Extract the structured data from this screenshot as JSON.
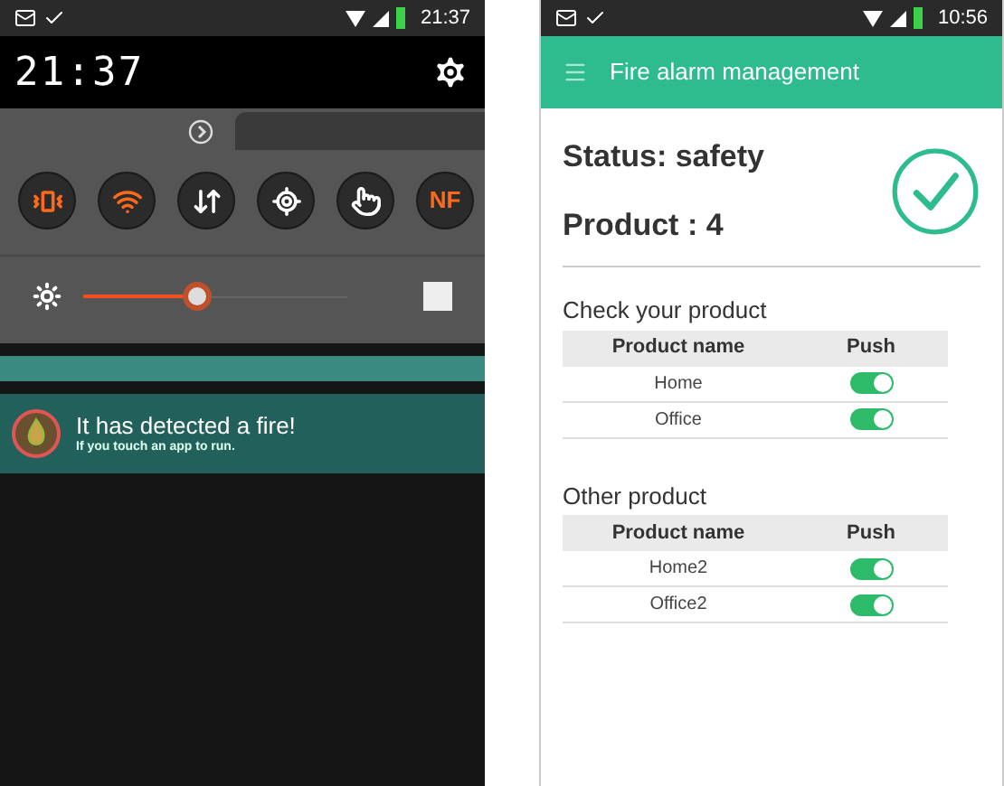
{
  "notification_shade": {
    "status_bar": {
      "time": "21:37"
    },
    "clock": "21:37",
    "toggles": [
      {
        "kind": "vibrate",
        "on": true
      },
      {
        "kind": "wifi",
        "on": true
      },
      {
        "kind": "data",
        "on": false
      },
      {
        "kind": "location",
        "on": false
      },
      {
        "kind": "touch",
        "on": false
      },
      {
        "kind": "nfc",
        "label": "NF",
        "on": true
      }
    ],
    "brightness": {
      "level": 0.43,
      "auto": false
    },
    "notification": {
      "title": "It has detected a fire!",
      "text": "If you touch an app to run."
    }
  },
  "app": {
    "status_bar": {
      "time": "10:56"
    },
    "app_bar": {
      "title": "Fire alarm management"
    },
    "status": "Status: safety",
    "product": "Product : 4",
    "safe": true,
    "sections": [
      {
        "title": "Check your product",
        "columns": [
          "Product name",
          "Push"
        ],
        "rows": [
          {
            "name": "Home",
            "push": true
          },
          {
            "name": "Office",
            "push": true
          }
        ]
      },
      {
        "title": "Other product",
        "columns": [
          "Product name",
          "Push"
        ],
        "rows": [
          {
            "name": "Home2",
            "push": true
          },
          {
            "name": "Office2",
            "push": true
          }
        ]
      }
    ]
  }
}
